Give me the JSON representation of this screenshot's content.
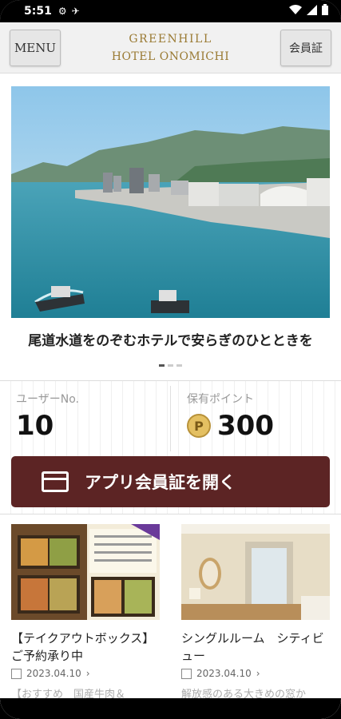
{
  "status": {
    "time": "5:51"
  },
  "header": {
    "menu_label": "MENU",
    "logo_line1": "GREENHILL",
    "logo_line2": "HOTEL ONOMICHI",
    "member_label": "会員証"
  },
  "hero": {
    "caption": "尾道水道をのぞむホテルで安らぎのひとときを"
  },
  "points": {
    "user_label": "ユーザーNo.",
    "user_no": "10",
    "points_label": "保有ポイント",
    "points_value": "300",
    "coin_letter": "P"
  },
  "open_card": {
    "label": "アプリ会員証を開く"
  },
  "news": [
    {
      "title": "【テイクアウトボックス】ご予約承り中",
      "date": "2023.04.10",
      "excerpt": "【おすすめ　国産牛肉＆"
    },
    {
      "title": "シングルルーム　シティビュー",
      "date": "2023.04.10",
      "excerpt": "解放感のある大きめの窓か"
    }
  ],
  "colors": {
    "accent": "#5c2424",
    "gold": "#9a7a33"
  }
}
